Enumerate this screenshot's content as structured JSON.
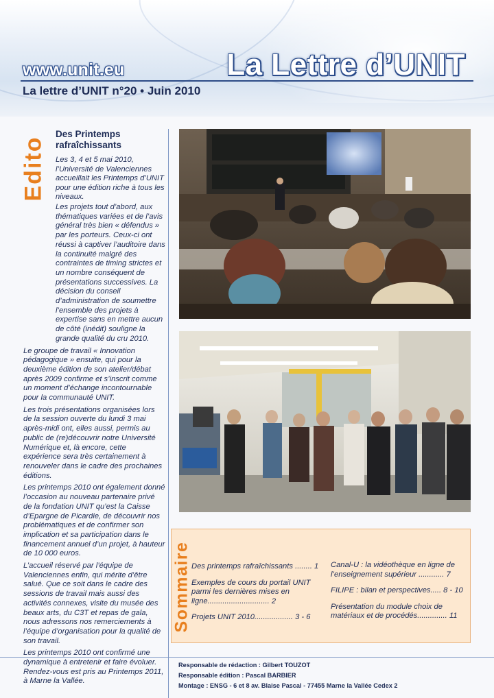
{
  "header": {
    "url": "www.unit.eu",
    "masthead": "La Lettre d’UNIT",
    "issue": "La lettre d’UNIT n°20 • Juin 2010"
  },
  "edito": {
    "section_title": "Edito",
    "heading": "Des Printemps rafraîchissants",
    "intro": "Les 3, 4 et 5 mai 2010, l’Université de Valenciennes accueillait les Printemps d’UNIT pour une édition riche à tous les niveaux.",
    "paragraphs": [
      "Les projets tout d’abord, aux thématiques variées et de l’avis général très bien « défendus » par les porteurs. Ceux-ci ont réussi à captiver l’auditoire dans la continuité malgré des contraintes de timing strictes et un nombre conséquent de présentations successives. La décision du conseil d’administration de soumettre l’ensemble des projets à expertise sans en mettre aucun de côté (inédit) souligne la grande qualité du cru 2010.",
      "Le groupe de travail « Innovation pédagogique » ensuite, qui pour la deuxième édition de son atelier/débat après 2009 confirme et s’inscrit comme un moment d’échange incontournable pour la communauté UNIT.",
      "Les trois présentations organisées lors de la session ouverte du lundi 3 mai après-midi ont, elles aussi, permis au public de (re)découvrir notre Université Numérique et, là encore, cette expérience sera très certainement à renouveler dans le cadre des prochaines éditions.",
      "Les printemps 2010 ont également donné l’occasion au nouveau partenaire privé de la fondation UNIT qu’est la Caisse d’Epargne de Picardie, de découvrir nos problématiques et de confirmer son implication et sa participation dans le financement annuel d’un projet, à hauteur de 10 000 euros.",
      "L’accueil réservé par l’équipe de Valenciennes enfin, qui mérite d’être salué. Que ce soit dans le cadre des sessions de travail mais aussi des activités connexes, visite du musée des beaux arts, du C3T et repas de gala, nous adressons nos remerciements à l’équipe d’organisation pour la qualité de son travail.",
      "Les printemps 2010 ont confirmé une dynamique à entretenir et faire évoluer. Rendez-vous est pris au Printemps 2011, à Marne la Vallée."
    ]
  },
  "sommaire": {
    "title": "Sommaire",
    "left": [
      "Des printemps rafraîchissants ........ 1",
      "Exemples de cours du portail UNIT parmi les dernières mises en ligne............................. 2",
      "Projets UNIT 2010.................. 3 - 6"
    ],
    "right": [
      "Canal-U : la vidéothèque en ligne de l’enseignement supérieur ............ 7",
      "FILIPE : bilan et perspectives..... 8 - 10",
      "Présentation du module choix de matériaux et de procédés.............. 11"
    ]
  },
  "credits": {
    "line1": "Responsable de rédaction : Gilbert TOUZOT",
    "line2": "Responsable édition : Pascal BARBIER",
    "line3": "Montage : ENSG - 6 et 8 av. Blaise Pascal - 77455 Marne la Vallée Cedex 2"
  },
  "colors": {
    "navy": "#1d2b55",
    "orange": "#e87f1e",
    "sommaire_bg": "#fde8d0"
  }
}
